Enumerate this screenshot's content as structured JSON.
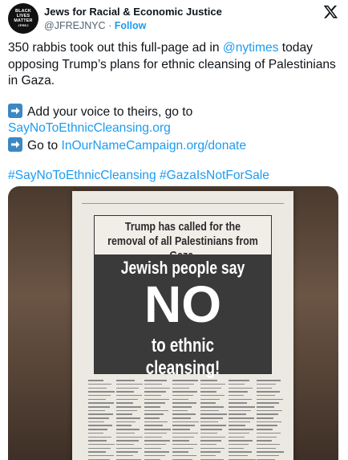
{
  "header": {
    "account_name": "Jews for Racial & Economic Justice",
    "handle": "@JFREJNYC",
    "separator": "·",
    "follow_label": "Follow",
    "avatar_lines": [
      "BLACK",
      "LIVES",
      "MATTER",
      "JFREJ"
    ]
  },
  "tweet": {
    "line1_pre": "350 rabbis took out this full-page ad in ",
    "line1_mention": "@nytimes",
    "line1_post": " today opposing Trump’s plans for ethnic cleansing of Palestinians in Gaza.",
    "cta1_text": "Add your voice to theirs, go to",
    "cta1_link": "SayNoToEthnicCleansing.org",
    "cta2_text": "Go to ",
    "cta2_link": "InOurNameCampaign.org/donate",
    "hashtag1": "#SayNoToEthnicCleansing",
    "hashtag2": "#GazaIsNotForSale"
  },
  "ad": {
    "headline": "Trump has called for the removal of all Palestinians from Gaza.",
    "line_jewish": "Jewish people say",
    "line_no": "NO",
    "line_ethnic": "to ethnic cleansing!"
  },
  "icons": {
    "logo": "x-logo-icon",
    "arrow": "right-arrow-emoji-icon"
  },
  "colors": {
    "link": "#1d9bf0",
    "text": "#0f1419",
    "muted": "#536471",
    "ad_dark": "#3a3a3a"
  }
}
